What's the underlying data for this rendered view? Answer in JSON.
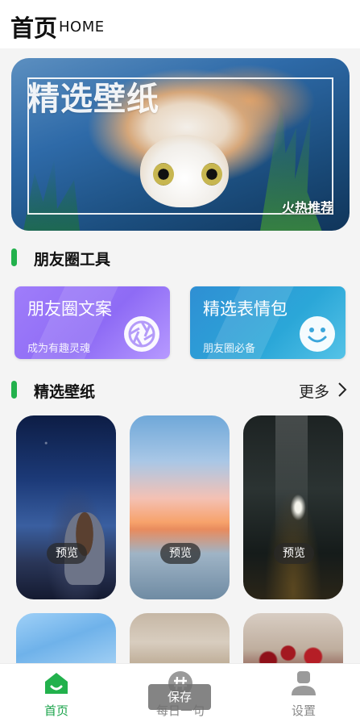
{
  "header": {
    "title": "首页",
    "subtitle": "HOME"
  },
  "banner": {
    "title": "精选壁纸",
    "tag": "火热推荐"
  },
  "tools_section": {
    "label": "朋友圈工具"
  },
  "tools": [
    {
      "name": "朋友圈文案",
      "sub": "成为有趣灵魂",
      "icon": "aperture-icon",
      "color": "#9f7dfa"
    },
    {
      "name": "精选表情包",
      "sub": "朋友圈必备",
      "icon": "smiley-icon",
      "color": "#2f8fd4"
    }
  ],
  "wallpaper_section": {
    "label": "精选壁纸",
    "more": "更多"
  },
  "wallpapers": [
    {
      "preview": "预览"
    },
    {
      "preview": "预览"
    },
    {
      "preview": "预览"
    }
  ],
  "toast": "保存",
  "tabs": [
    {
      "label": "首页",
      "icon": "home-icon",
      "active": true
    },
    {
      "label": "每日一句",
      "icon": "hash-icon",
      "active": false
    },
    {
      "label": "设置",
      "icon": "user-icon",
      "active": false
    }
  ],
  "colors": {
    "accent": "#22b14c",
    "tab_active": "#1aa34a"
  }
}
